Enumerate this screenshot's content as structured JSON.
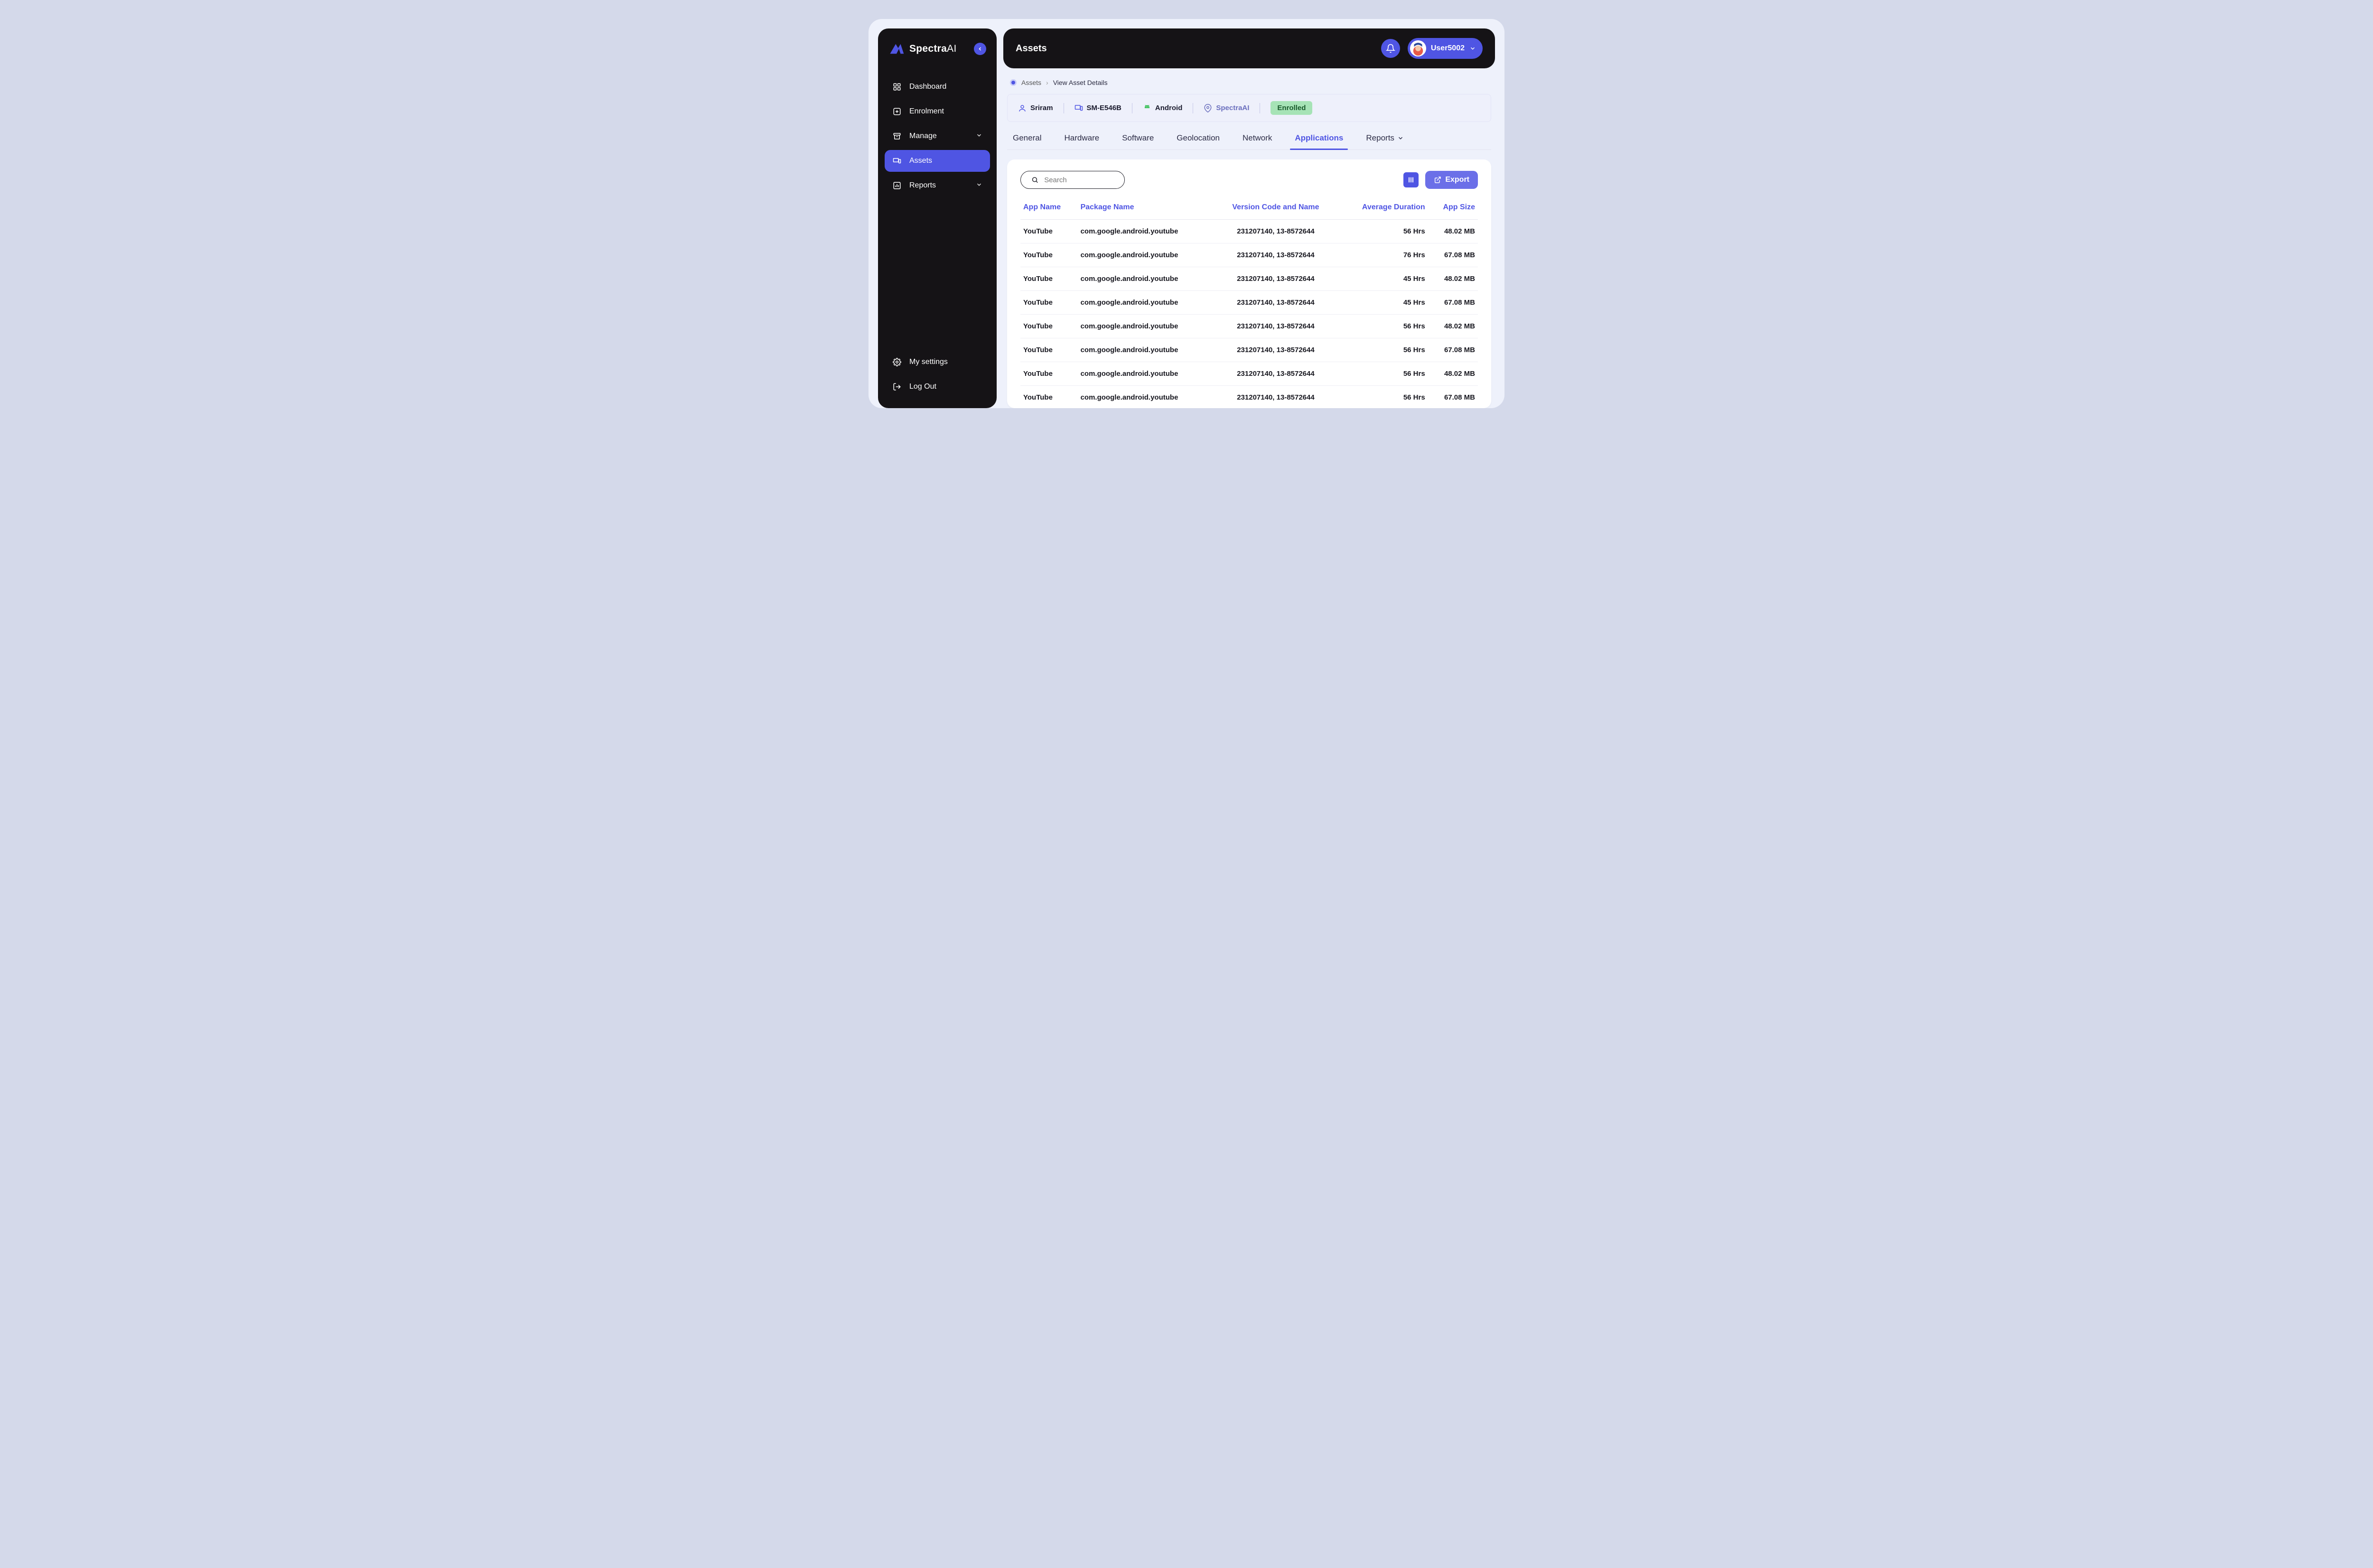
{
  "brand": {
    "name_bold": "Spectra",
    "name_thin": "AI"
  },
  "sidebar": {
    "items": [
      {
        "label": "Dashboard"
      },
      {
        "label": "Enrolment"
      },
      {
        "label": "Manage"
      },
      {
        "label": "Assets"
      },
      {
        "label": "Reports"
      }
    ],
    "bottom": [
      {
        "label": "My settings"
      },
      {
        "label": "Log Out"
      }
    ]
  },
  "header": {
    "title": "Assets",
    "user": "User5002"
  },
  "breadcrumb": {
    "root": "Assets",
    "current": "View Asset Details"
  },
  "meta": {
    "owner": "Sriram",
    "device": "SM-E546B",
    "os": "Android",
    "org": "SpectraAI",
    "status": "Enrolled"
  },
  "tabs": [
    "General",
    "Hardware",
    "Software",
    "Geolocation",
    "Network",
    "Applications",
    "Reports"
  ],
  "active_tab": "Applications",
  "toolbar": {
    "search_placeholder": "Search",
    "export_label": "Export"
  },
  "columns": [
    "App Name",
    "Package Name",
    "Version Code and Name",
    "Average Duration",
    "App Size"
  ],
  "rows": [
    {
      "app": "YouTube",
      "pkg": "com.google.android.youtube",
      "ver": "231207140, 13-8572644",
      "dur": "56 Hrs",
      "size": "48.02 MB"
    },
    {
      "app": "YouTube",
      "pkg": "com.google.android.youtube",
      "ver": "231207140, 13-8572644",
      "dur": "76 Hrs",
      "size": "67.08 MB"
    },
    {
      "app": "YouTube",
      "pkg": "com.google.android.youtube",
      "ver": "231207140, 13-8572644",
      "dur": "45 Hrs",
      "size": "48.02 MB"
    },
    {
      "app": "YouTube",
      "pkg": "com.google.android.youtube",
      "ver": "231207140, 13-8572644",
      "dur": "45 Hrs",
      "size": "67.08 MB"
    },
    {
      "app": "YouTube",
      "pkg": "com.google.android.youtube",
      "ver": "231207140, 13-8572644",
      "dur": "56 Hrs",
      "size": "48.02 MB"
    },
    {
      "app": "YouTube",
      "pkg": "com.google.android.youtube",
      "ver": "231207140, 13-8572644",
      "dur": "56 Hrs",
      "size": "67.08 MB"
    },
    {
      "app": "YouTube",
      "pkg": "com.google.android.youtube",
      "ver": "231207140, 13-8572644",
      "dur": "56 Hrs",
      "size": "48.02 MB"
    },
    {
      "app": "YouTube",
      "pkg": "com.google.android.youtube",
      "ver": "231207140, 13-8572644",
      "dur": "56 Hrs",
      "size": "67.08 MB"
    }
  ]
}
